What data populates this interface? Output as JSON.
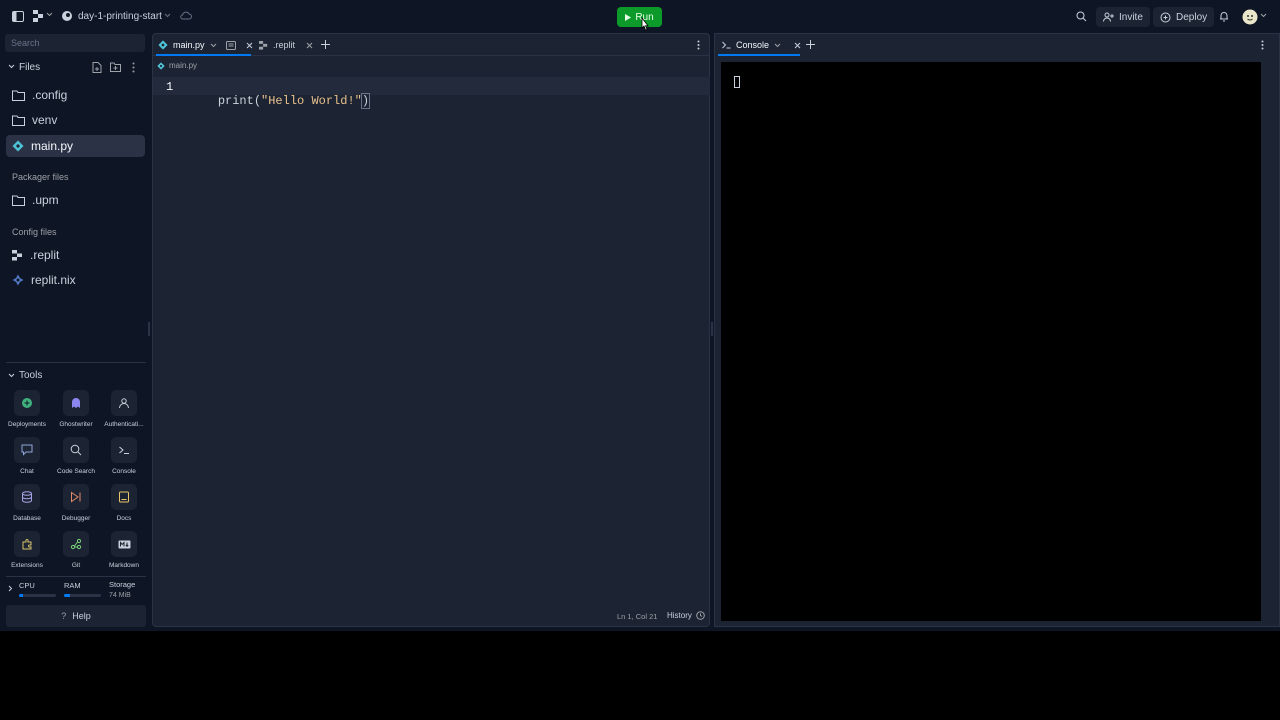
{
  "topbar": {
    "project_name": "day-1-printing-start",
    "run_label": "Run",
    "invite_label": "Invite",
    "deploy_label": "Deploy"
  },
  "sidebar": {
    "search_placeholder": "Search",
    "files_title": "Files",
    "files": [
      {
        "name": ".config",
        "icon": "folder-icon"
      },
      {
        "name": "venv",
        "icon": "folder-icon"
      },
      {
        "name": "main.py",
        "icon": "python-icon",
        "active": true
      }
    ],
    "packager_title": "Packager files",
    "packager_files": [
      {
        "name": ".upm",
        "icon": "folder-icon"
      }
    ],
    "config_title": "Config files",
    "config_files": [
      {
        "name": ".replit",
        "icon": "replit-icon"
      },
      {
        "name": "replit.nix",
        "icon": "nix-icon"
      }
    ],
    "tools_title": "Tools",
    "tools": [
      {
        "label": "Deployments",
        "icon": "deployments-icon"
      },
      {
        "label": "Ghostwriter",
        "icon": "ghostwriter-icon"
      },
      {
        "label": "Authenticati...",
        "icon": "auth-icon"
      },
      {
        "label": "Chat",
        "icon": "chat-icon"
      },
      {
        "label": "Code Search",
        "icon": "search-icon"
      },
      {
        "label": "Console",
        "icon": "console-icon"
      },
      {
        "label": "Database",
        "icon": "database-icon"
      },
      {
        "label": "Debugger",
        "icon": "debugger-icon"
      },
      {
        "label": "Docs",
        "icon": "docs-icon"
      },
      {
        "label": "Extensions",
        "icon": "extensions-icon"
      },
      {
        "label": "Git",
        "icon": "git-icon"
      },
      {
        "label": "Markdown",
        "icon": "markdown-icon"
      }
    ],
    "resources": {
      "cpu_label": "CPU",
      "ram_label": "RAM",
      "storage_label": "Storage",
      "storage_value": "74 MiB",
      "cpu_fraction": 0.1,
      "ram_fraction": 0.15
    },
    "help_label": "Help"
  },
  "editor": {
    "tabs": [
      {
        "label": "main.py",
        "active": true
      },
      {
        "label": ".replit",
        "active": false
      }
    ],
    "breadcrumb": "main.py",
    "code_lines": [
      {
        "number": "1",
        "prefix": "print(",
        "string": "\"Hello World!\"",
        "suffix": ")"
      }
    ],
    "status_position": "Ln 1, Col 21",
    "history_label": "History"
  },
  "console": {
    "tab_label": "Console"
  },
  "colors": {
    "background": "#0e1525",
    "panel": "#1c2333",
    "run_green": "#0c9b2a",
    "string_orange": "#e8c18c"
  }
}
